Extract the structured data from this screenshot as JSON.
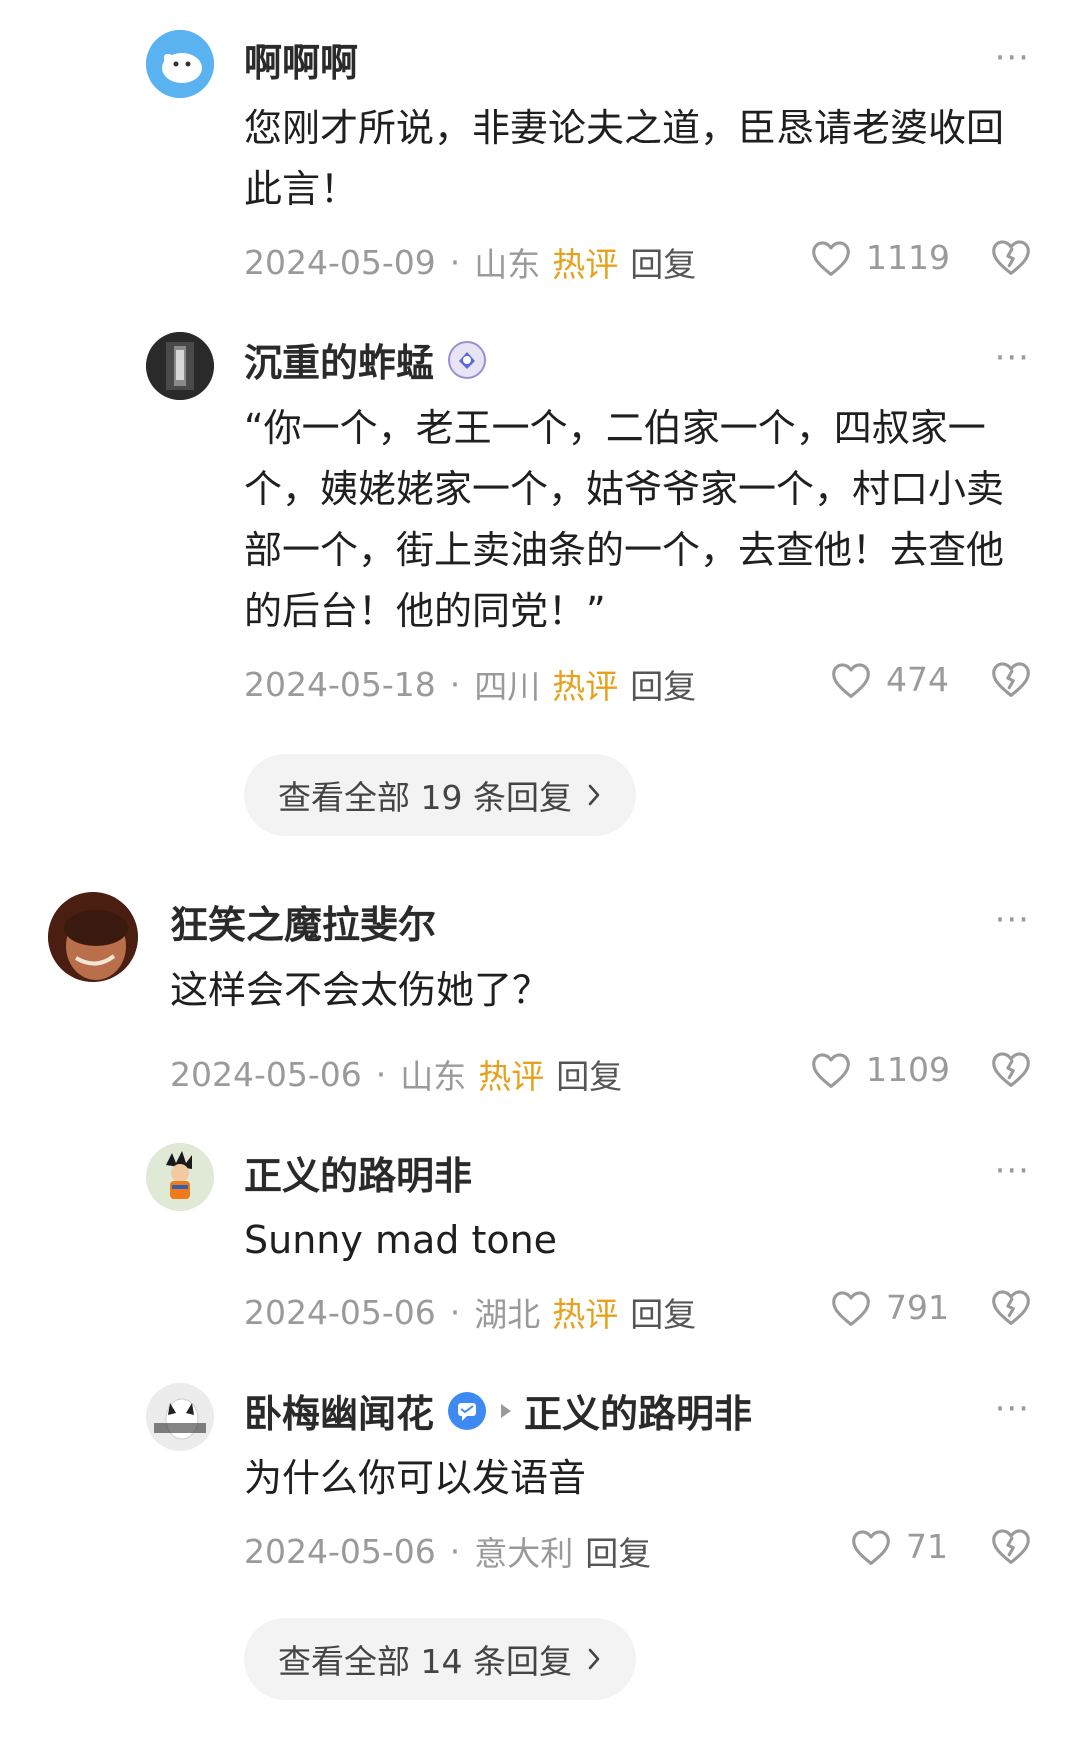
{
  "comments": [
    {
      "username": "啊啊啊",
      "text": "您刚才所说，非妻论夫之道，臣恳请老婆收回此言！",
      "date": "2024-05-09",
      "location": "山东",
      "hot": "热评",
      "reply": "回复",
      "likes": "1119"
    },
    {
      "username": "沉重的蚱蜢",
      "text": "“你一个，老王一个，二伯家一个，四叔家一个，姨姥姥家一个，姑爷爷家一个，村口小卖部一个，街上卖油条的一个，去查他！去查他的后台！他的同党！”",
      "date": "2024-05-18",
      "location": "四川",
      "hot": "热评",
      "reply": "回复",
      "likes": "474"
    },
    {
      "username": "狂笑之魔拉斐尔",
      "text": "这样会不会太伤她了？",
      "date": "2024-05-06",
      "location": "山东",
      "hot": "热评",
      "reply": "回复",
      "likes": "1109"
    },
    {
      "username": "正义的路明非",
      "text": "Sunny mad tone",
      "date": "2024-05-06",
      "location": "湖北",
      "hot": "热评",
      "reply": "回复",
      "likes": "791"
    },
    {
      "username": "卧梅幽闻花",
      "reply_to": "正义的路明非",
      "text": "为什么你可以发语音",
      "date": "2024-05-06",
      "location": "意大利",
      "reply": "回复",
      "likes": "71"
    }
  ],
  "view_all_1": "查看全部 19 条回复",
  "view_all_2": "查看全部 14 条回复",
  "separator": "·",
  "more": "···",
  "icons": {
    "like": "heart-icon",
    "dislike": "broken-heart-icon",
    "more": "more-icon",
    "chevron": "chevron-right-icon"
  },
  "colors": {
    "hot": "#e6a21e",
    "muted": "#9a9a9a",
    "badge_blue": "#3d8bf2"
  }
}
